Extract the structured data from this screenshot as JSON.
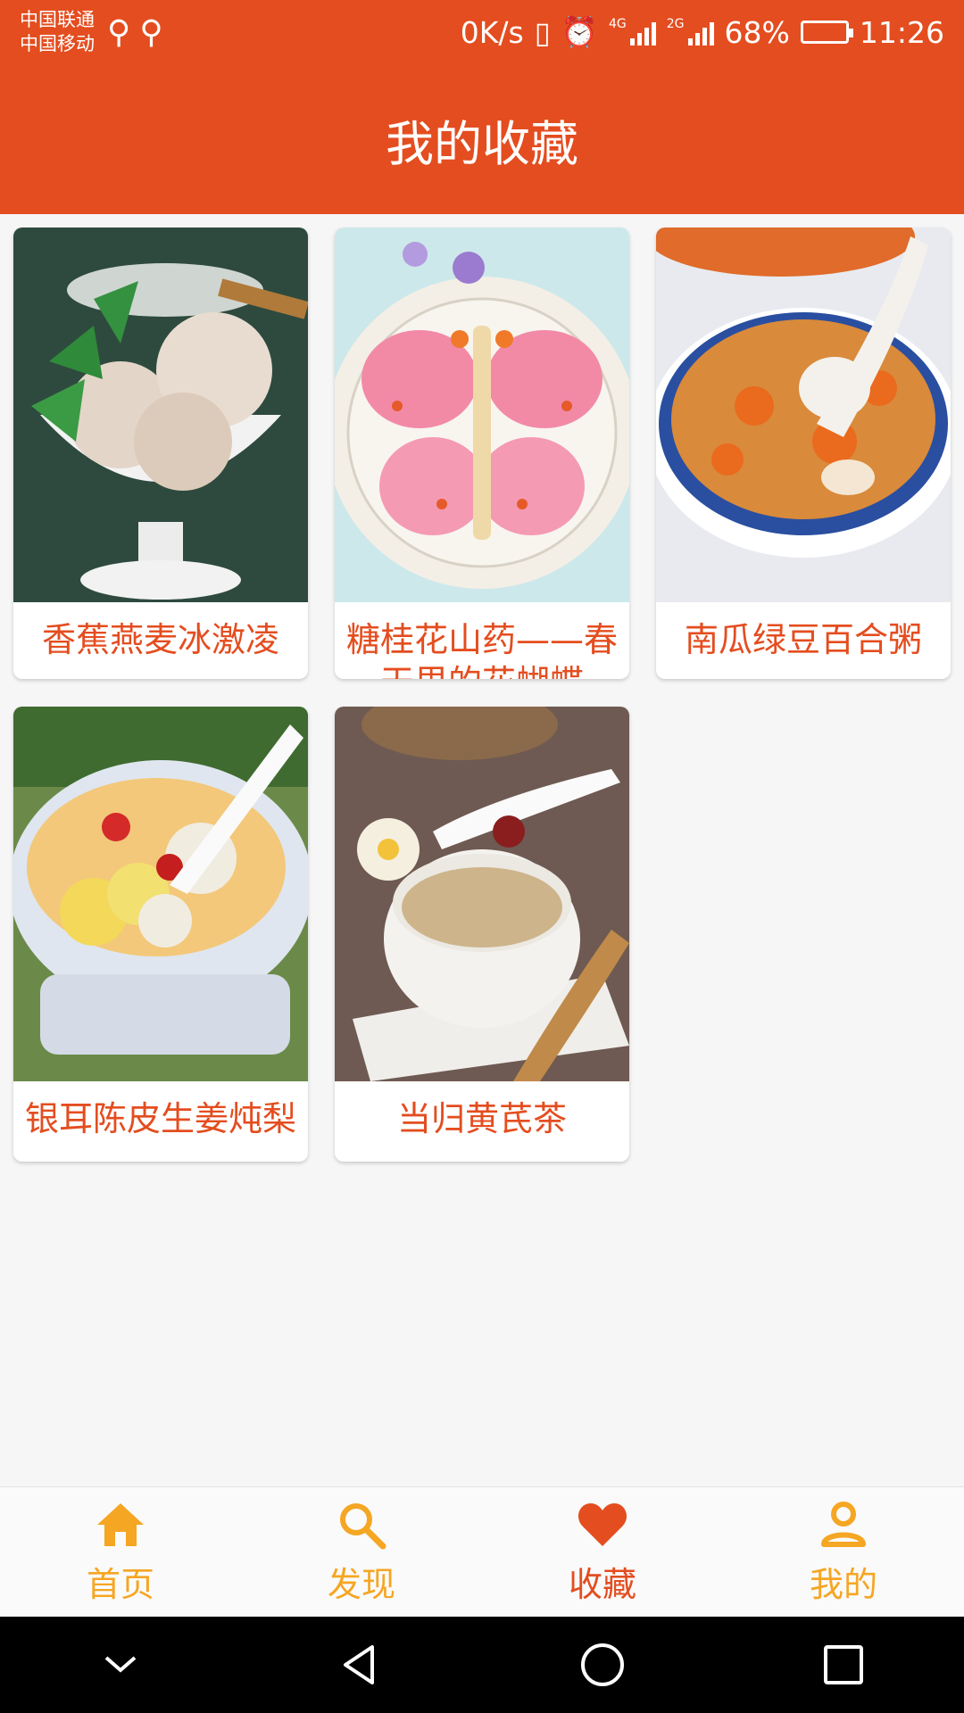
{
  "status_bar": {
    "carrier_1": "中国联通",
    "carrier_2": "中国移动",
    "usb_icons": [
      "usb-icon",
      "usb-icon"
    ],
    "net_speed": "0K/s",
    "net_tag_1": "4G",
    "net_tag_2": "2G",
    "battery": "68%",
    "battery_level": 0.68,
    "time": "11:26"
  },
  "header": {
    "title": "我的收藏"
  },
  "favorites": [
    {
      "name": "香蕉燕麦冰激凌",
      "image": "ice-cream-photo"
    },
    {
      "name": "糖桂花山药——春天里的花蝴蝶",
      "image": "butterfly-yam-photo"
    },
    {
      "name": "南瓜绿豆百合粥",
      "image": "pumpkin-porridge-photo"
    },
    {
      "name": "银耳陈皮生姜炖梨",
      "image": "tremella-soup-photo"
    },
    {
      "name": "当归黄芪茶",
      "image": "herbal-tea-photo"
    }
  ],
  "bottom_nav": [
    {
      "label": "首页",
      "icon": "home-icon",
      "active": false
    },
    {
      "label": "发现",
      "icon": "search-icon",
      "active": false
    },
    {
      "label": "收藏",
      "icon": "heart-icon",
      "active": true
    },
    {
      "label": "我的",
      "icon": "person-icon",
      "active": false
    }
  ],
  "colors": {
    "primary": "#e44d1f",
    "nav_inactive": "#f5a623",
    "nav_active": "#e44d1f"
  },
  "system_nav": [
    "collapse-icon",
    "back-icon",
    "home-circle-icon",
    "recents-icon"
  ]
}
